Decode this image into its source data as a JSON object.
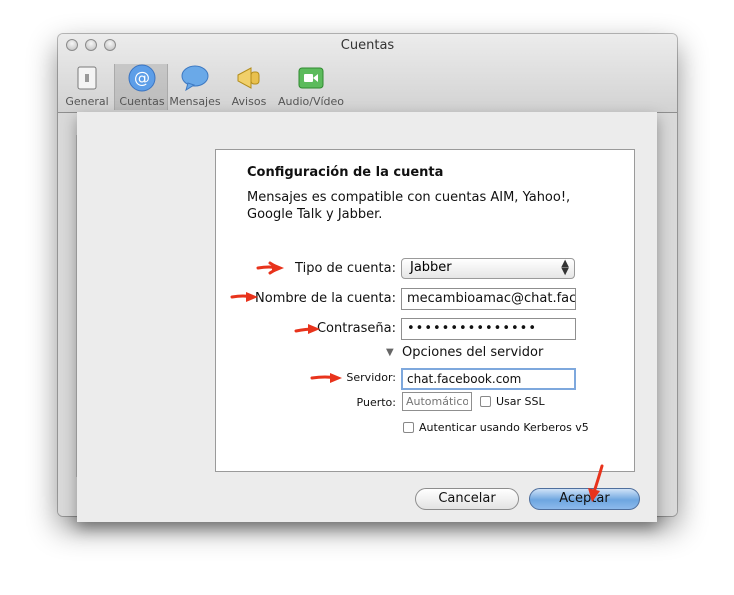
{
  "window": {
    "title": "Cuentas",
    "toolbar": [
      {
        "label": "General",
        "icon": "general-icon"
      },
      {
        "label": "Cuentas",
        "icon": "at-sign-icon"
      },
      {
        "label": "Mensajes",
        "icon": "speech-bubble-icon"
      },
      {
        "label": "Avisos",
        "icon": "megaphone-icon"
      },
      {
        "label": "Audio/Vídeo",
        "icon": "video-camera-icon"
      }
    ],
    "selected_tab": "Cuentas"
  },
  "sheet": {
    "heading": "Configuración de la cuenta",
    "description": "Mensajes es compatible con cuentas AIM, Yahoo!, Google Talk y Jabber.",
    "account_type": {
      "label": "Tipo de cuenta:",
      "value": "Jabber"
    },
    "account_name": {
      "label": "Nombre de la cuenta:",
      "value": "mecambioamac@chat.face"
    },
    "password": {
      "label": "Contraseña:",
      "value": "•••••••••••••••"
    },
    "server_options": {
      "label": "Opciones del servidor"
    },
    "server": {
      "label": "Servidor:",
      "value": "chat.facebook.com"
    },
    "port": {
      "label": "Puerto:",
      "placeholder": "Automático"
    },
    "use_ssl": {
      "label": "Usar SSL",
      "checked": false
    },
    "kerberos": {
      "label": "Autenticar usando Kerberos v5",
      "checked": false
    },
    "cancel_label": "Cancelar",
    "accept_label": "Aceptar"
  },
  "colors": {
    "annotation_arrow": "#e8331c",
    "default_button": "#6ea6e0"
  }
}
